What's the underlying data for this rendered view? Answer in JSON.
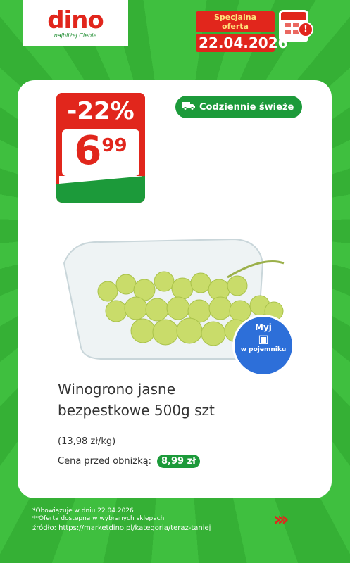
{
  "header": {
    "logo_text": "dino",
    "logo_tagline": "najbliżej Ciebie",
    "offer_label": "Specjalna oferta",
    "offer_date": "22.04.2026",
    "calendar_alert": "!"
  },
  "product": {
    "discount": "-22%",
    "price_integer": "6",
    "price_decimal": "99",
    "fresh_badge": "Codziennie świeże",
    "title_line1": "Winogrono jasne",
    "title_line2": "bezpestkowe 500g szt",
    "unit_price": "(13,98 zł/kg)",
    "before_label": "Cena przed obniżką:",
    "before_price": "8,99 zł",
    "wash_top": "Myj",
    "wash_bottom": "w pojemniku"
  },
  "footer": {
    "note1": "*Obowiązuje w dniu 22.04.2026",
    "note2": "**Oferta dostępna w wybranych sklepach",
    "source": "źródło: https://marketdino.pl/kategoria/teraz-taniej"
  },
  "colors": {
    "brand_red": "#e1261c",
    "brand_green": "#1c9a3a",
    "background_green": "#3fbf3f",
    "wash_blue": "#2d6fd9"
  }
}
